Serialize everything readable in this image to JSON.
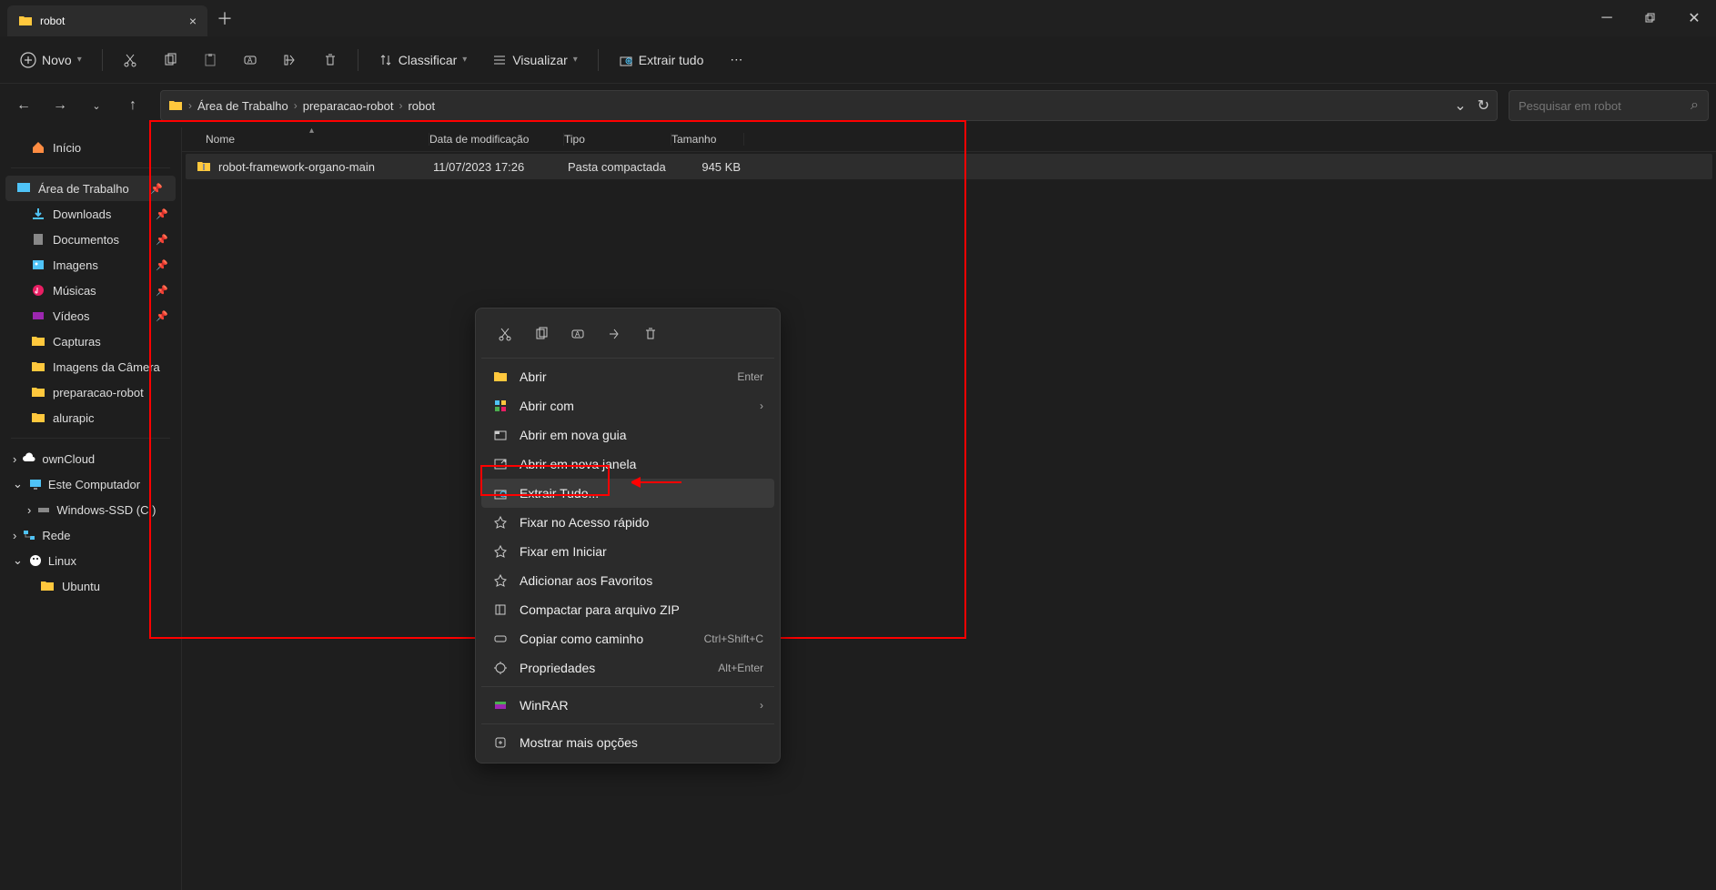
{
  "titlebar": {
    "tab_title": "robot"
  },
  "toolbar": {
    "new": "Novo",
    "sort": "Classificar",
    "view": "Visualizar",
    "extract": "Extrair tudo"
  },
  "breadcrumb": {
    "items": [
      "Área de Trabalho",
      "preparacao-robot",
      "robot"
    ]
  },
  "search": {
    "placeholder": "Pesquisar em robot"
  },
  "sidebar": {
    "home": "Início",
    "pinned": [
      {
        "label": "Área de Trabalho"
      },
      {
        "label": "Downloads"
      },
      {
        "label": "Documentos"
      },
      {
        "label": "Imagens"
      },
      {
        "label": "Músicas"
      },
      {
        "label": "Vídeos"
      },
      {
        "label": "Capturas"
      },
      {
        "label": "Imagens da Câmera"
      },
      {
        "label": "preparacao-robot"
      },
      {
        "label": "alurapic"
      }
    ],
    "cloud": "ownCloud",
    "this_pc": "Este Computador",
    "drive": "Windows-SSD (C:)",
    "network": "Rede",
    "linux": "Linux",
    "ubuntu": "Ubuntu"
  },
  "columns": {
    "name": "Nome",
    "date": "Data de modificação",
    "type": "Tipo",
    "size": "Tamanho"
  },
  "files": [
    {
      "name": "robot-framework-organo-main",
      "date": "11/07/2023 17:26",
      "type": "Pasta compactada",
      "size": "945 KB"
    }
  ],
  "context_menu": {
    "open": "Abrir",
    "open_hint": "Enter",
    "open_with": "Abrir com",
    "open_tab": "Abrir em nova guia",
    "open_window": "Abrir em nova janela",
    "extract_all": "Extrair Tudo...",
    "pin_quick": "Fixar no Acesso rápido",
    "pin_start": "Fixar em Iniciar",
    "add_fav": "Adicionar aos Favoritos",
    "compress": "Compactar para arquivo ZIP",
    "copy_path": "Copiar como caminho",
    "copy_path_hint": "Ctrl+Shift+C",
    "properties": "Propriedades",
    "properties_hint": "Alt+Enter",
    "winrar": "WinRAR",
    "more": "Mostrar mais opções"
  }
}
